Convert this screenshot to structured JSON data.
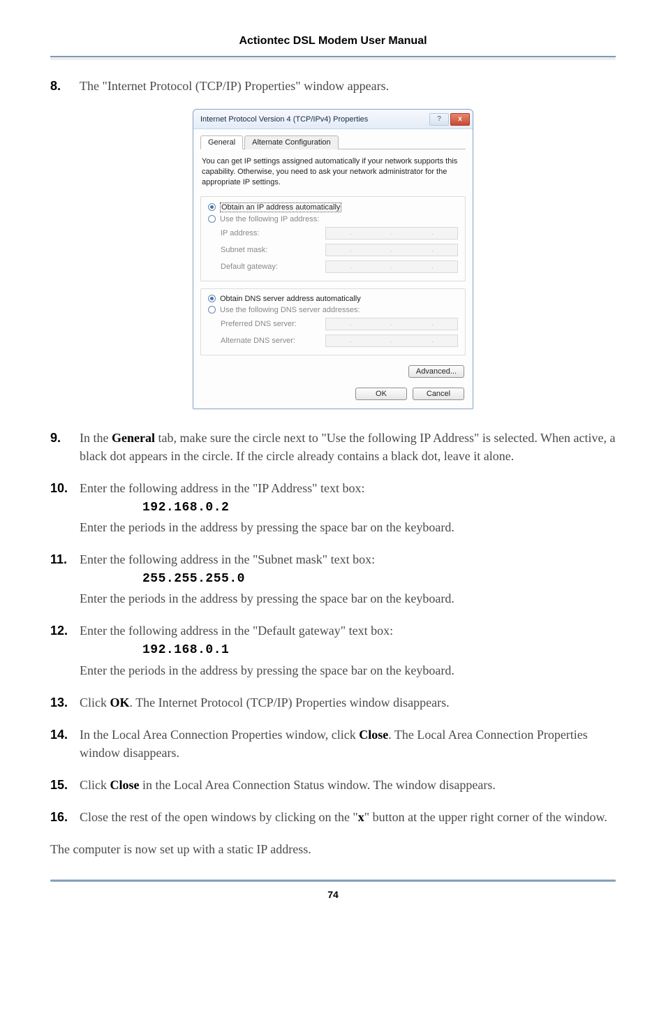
{
  "header": {
    "title": "Actiontec DSL Modem User Manual"
  },
  "steps": {
    "s8": {
      "num": "8.",
      "text": "The \"Internet Protocol (TCP/IP) Properties\" window appears."
    },
    "s9": {
      "num": "9.",
      "lead": "In the ",
      "bold1": "General",
      "mid": " tab, make sure the circle next to \"Use the following IP Address\" is selected. When active, a black dot appears in the circle. If the circle already contains a black dot, leave it alone."
    },
    "s10": {
      "num": "10.",
      "line1": "Enter the following address in the \"IP Address\" text box:",
      "code": "192.168.0.2",
      "line2": "Enter the periods in the address by pressing the space bar on the keyboard."
    },
    "s11": {
      "num": "11.",
      "line1": "Enter the following address in the \"Subnet mask\" text box:",
      "code": "255.255.255.0",
      "line2": "Enter the periods in the address by pressing the space bar on the keyboard."
    },
    "s12": {
      "num": "12.",
      "line1": "Enter the following address in the \"Default gateway\" text box:",
      "code": "192.168.0.1",
      "line2": "Enter the periods in the address by pressing the space bar on the keyboard."
    },
    "s13": {
      "num": "13.",
      "pre": "Click ",
      "bold": "OK",
      "post": ". The Internet Protocol (TCP/IP) Properties window disappears."
    },
    "s14": {
      "num": "14.",
      "pre": "In the Local Area Connection Properties window, click ",
      "bold": "Close",
      "post": ". The Local Area Connection Properties window disappears."
    },
    "s15": {
      "num": "15.",
      "pre": "Click ",
      "bold": "Close",
      "post": " in the Local Area Connection Status window. The window disappears."
    },
    "s16": {
      "num": "16.",
      "pre": "Close the rest of the open windows by clicking on the \"",
      "bold": "x",
      "post": "\" button at the upper right corner of the window."
    }
  },
  "closing": "The computer is now set up with a static IP address.",
  "dialog": {
    "title": "Internet Protocol Version 4 (TCP/IPv4) Properties",
    "help": "?",
    "close": "x",
    "tabs": {
      "general": "General",
      "alt": "Alternate Configuration"
    },
    "desc": "You can get IP settings assigned automatically if your network supports this capability. Otherwise, you need to ask your network administrator for the appropriate IP settings.",
    "radio_auto_ip": "Obtain an IP address automatically",
    "radio_use_ip": "Use the following IP address:",
    "ip_label": "IP address:",
    "subnet_label": "Subnet mask:",
    "gateway_label": "Default gateway:",
    "radio_auto_dns": "Obtain DNS server address automatically",
    "radio_use_dns": "Use the following DNS server addresses:",
    "pref_dns": "Preferred DNS server:",
    "alt_dns": "Alternate DNS server:",
    "advanced": "Advanced...",
    "ok": "OK",
    "cancel": "Cancel"
  },
  "page_number": "74"
}
